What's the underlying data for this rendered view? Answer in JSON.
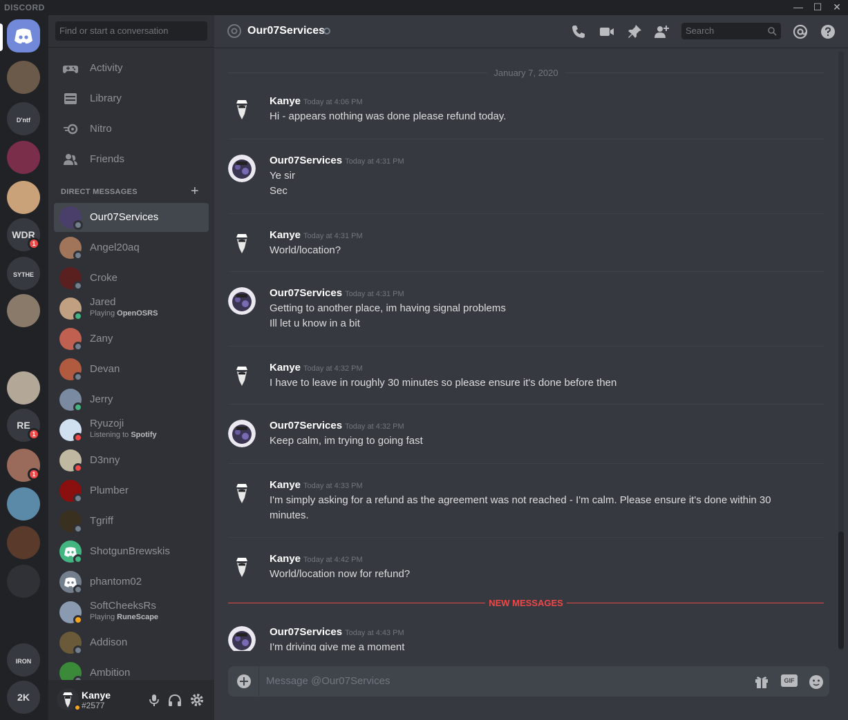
{
  "titlebar": {
    "brand": "DISCORD",
    "minimize": "—",
    "maximize": "☐",
    "close": "✕"
  },
  "guilds": {
    "home_icon": "discord-logo-icon",
    "items": [
      {
        "name": "guild-1",
        "color": "#6b5a4a"
      },
      {
        "name": "guild-dntf",
        "label": "D'ntf"
      },
      {
        "name": "guild-3",
        "color": "#7a2e4a"
      },
      {
        "name": "guild-4",
        "color": "#c9a27a"
      },
      {
        "name": "guild-wdr",
        "label": "WDR",
        "badge": "1"
      },
      {
        "name": "guild-sythe",
        "label": "SYTHE"
      },
      {
        "name": "guild-7",
        "color": "#8a7a6a"
      },
      {
        "name": "guild-8",
        "color": "#202225"
      },
      {
        "name": "guild-9",
        "color": "#b3a898"
      },
      {
        "name": "guild-re",
        "label": "RE",
        "badge": "1"
      },
      {
        "name": "guild-11",
        "color": "#9a6a5a",
        "badge": "1"
      },
      {
        "name": "guild-12",
        "color": "#5a8aa8"
      },
      {
        "name": "guild-13",
        "color": "#5a3a2a"
      },
      {
        "name": "guild-14",
        "color": "#2f3136"
      },
      {
        "name": "guild-15",
        "color": "#202225"
      },
      {
        "name": "guild-iron-pures",
        "label": "IRON PURES"
      },
      {
        "name": "guild-2k",
        "label": "2K"
      }
    ]
  },
  "sidebar": {
    "search_placeholder": "Find or start a conversation",
    "nav": [
      {
        "label": "Activity",
        "icon": "controller-icon"
      },
      {
        "label": "Library",
        "icon": "library-icon"
      },
      {
        "label": "Nitro",
        "icon": "nitro-icon"
      },
      {
        "label": "Friends",
        "icon": "friends-icon"
      }
    ],
    "dm_header": "DIRECT MESSAGES",
    "dm_add": "+",
    "dms": [
      {
        "name": "Our07Services",
        "status": "offline",
        "color": "#4a3f6a",
        "active": true
      },
      {
        "name": "Angel20aq",
        "status": "offline",
        "color": "#a0755a"
      },
      {
        "name": "Croke",
        "status": "offline",
        "color": "#5a2020"
      },
      {
        "name": "Jared",
        "status": "online",
        "color": "#c0a080",
        "activity_prefix": "Playing ",
        "activity_name": "OpenOSRS"
      },
      {
        "name": "Zany",
        "status": "offline",
        "color": "#c06050"
      },
      {
        "name": "Devan",
        "status": "offline",
        "color": "#b05a40"
      },
      {
        "name": "Jerry",
        "status": "online",
        "color": "#7a8aa0"
      },
      {
        "name": "Ryuzoji",
        "status": "dnd",
        "color": "#d0e0f0",
        "activity_prefix": "Listening to ",
        "activity_name": "Spotify"
      },
      {
        "name": "D3nny",
        "status": "dnd",
        "color": "#c0b8a0"
      },
      {
        "name": "Plumber",
        "status": "offline",
        "color": "#8a1010"
      },
      {
        "name": "Tgriff",
        "status": "offline",
        "color": "#3a3020"
      },
      {
        "name": "ShotgunBrewskis",
        "status": "online",
        "color": "#43b581",
        "default_avatar": true
      },
      {
        "name": "phantom02",
        "status": "offline",
        "color": "#747f8d",
        "default_avatar": true
      },
      {
        "name": "SoftCheeksRs",
        "status": "idle",
        "color": "#8a9ab0",
        "activity_prefix": "Playing ",
        "activity_name": "RuneScape"
      },
      {
        "name": "Addison",
        "status": "offline",
        "color": "#6a5a3a"
      },
      {
        "name": "Ambition",
        "status": "offline",
        "color": "#3a8a3a"
      }
    ],
    "user": {
      "name": "Kanye",
      "tag": "#2577",
      "status_color": "#faa61a"
    }
  },
  "chat": {
    "channel_name": "Our07Services",
    "header_icons": [
      "voice-call-icon",
      "video-call-icon",
      "pin-icon",
      "add-friend-icon",
      "mention-icon",
      "help-icon"
    ],
    "search_placeholder": "Search",
    "date_divider": "January 7, 2020",
    "new_messages_label": "NEW MESSAGES",
    "messages": [
      {
        "author": "Kanye",
        "time": "Today at 4:06 PM",
        "lines": [
          "Hi - appears nothing was done please refund today."
        ]
      },
      {
        "author": "Our07Services",
        "time": "Today at 4:31 PM",
        "lines": [
          "Ye sir",
          "Sec"
        ]
      },
      {
        "author": "Kanye",
        "time": "Today at 4:31 PM",
        "lines": [
          "World/location?"
        ]
      },
      {
        "author": "Our07Services",
        "time": "Today at 4:31 PM",
        "lines": [
          "Getting to another place, im having signal problems",
          "Ill let u know in a bit"
        ]
      },
      {
        "author": "Kanye",
        "time": "Today at 4:32 PM",
        "lines": [
          "I have to leave in roughly 30 minutes so please ensure it's done before then"
        ]
      },
      {
        "author": "Our07Services",
        "time": "Today at 4:32 PM",
        "lines": [
          "Keep calm, im trying to going fast"
        ]
      },
      {
        "author": "Kanye",
        "time": "Today at 4:33 PM",
        "lines": [
          "I'm simply asking for a refund as the agreement was not reached - I'm calm. Please ensure it's done within 30",
          "minutes."
        ]
      },
      {
        "author": "Kanye",
        "time": "Today at 4:42 PM",
        "lines": [
          "World/location now for refund?"
        ]
      },
      {
        "author": "Our07Services",
        "time": "Today at 4:43 PM",
        "lines": [
          "I'm driving give me a moment"
        ]
      }
    ],
    "composer": {
      "placeholder": "Message @Our07Services",
      "gif_label": "GIF",
      "icons": [
        "attach-plus-icon",
        "gift-icon",
        "gif-icon",
        "emoji-icon"
      ]
    }
  },
  "colors": {
    "blurple": "#7289da",
    "online": "#43b581",
    "idle": "#faa61a",
    "dnd": "#f04747",
    "offline": "#747f8d"
  }
}
